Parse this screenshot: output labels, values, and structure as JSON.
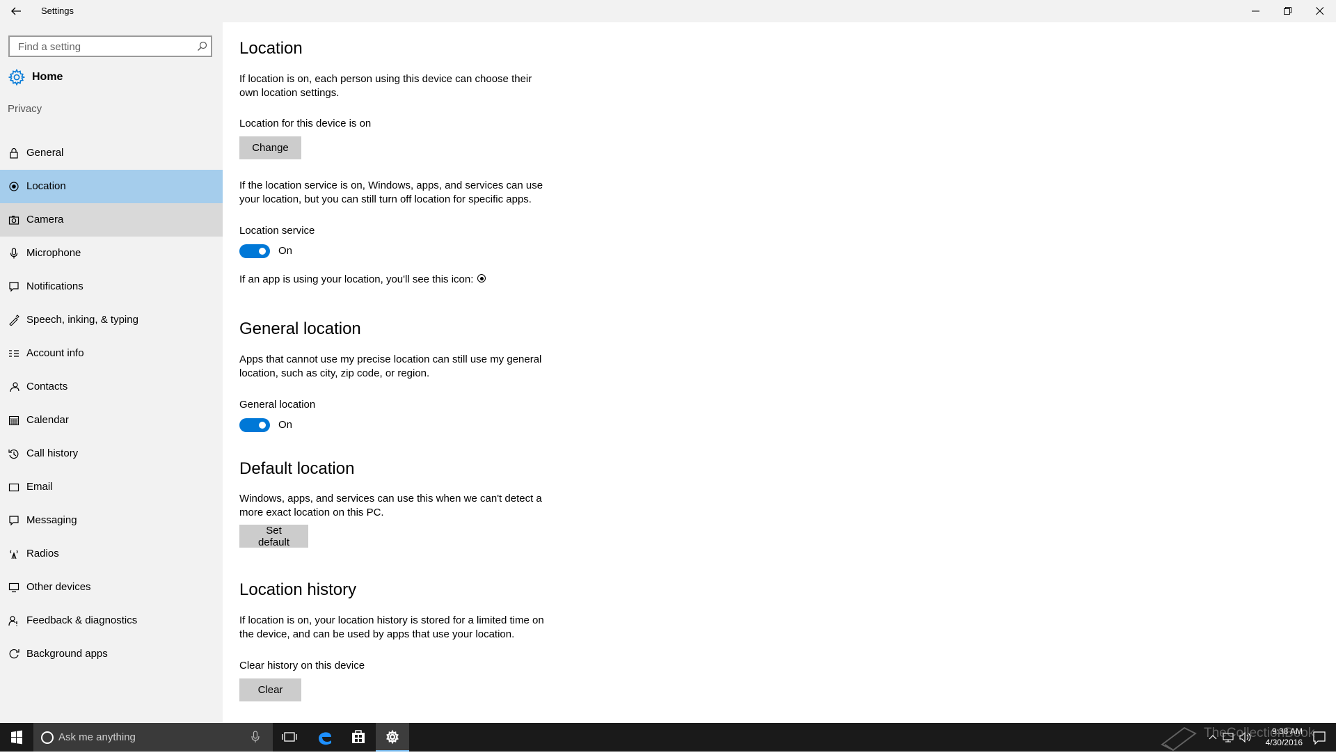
{
  "window": {
    "title": "Settings"
  },
  "sidebar": {
    "search_placeholder": "Find a setting",
    "home_label": "Home",
    "section": "Privacy",
    "items": [
      {
        "label": "General",
        "icon": "lock-icon"
      },
      {
        "label": "Location",
        "icon": "location-icon",
        "state": "selected"
      },
      {
        "label": "Camera",
        "icon": "camera-icon",
        "state": "hover"
      },
      {
        "label": "Microphone",
        "icon": "microphone-icon"
      },
      {
        "label": "Notifications",
        "icon": "notifications-icon"
      },
      {
        "label": "Speech, inking, & typing",
        "icon": "speech-icon"
      },
      {
        "label": "Account info",
        "icon": "account-info-icon"
      },
      {
        "label": "Contacts",
        "icon": "contacts-icon"
      },
      {
        "label": "Calendar",
        "icon": "calendar-icon"
      },
      {
        "label": "Call history",
        "icon": "call-history-icon"
      },
      {
        "label": "Email",
        "icon": "email-icon"
      },
      {
        "label": "Messaging",
        "icon": "messaging-icon"
      },
      {
        "label": "Radios",
        "icon": "radios-icon"
      },
      {
        "label": "Other devices",
        "icon": "other-devices-icon"
      },
      {
        "label": "Feedback & diagnostics",
        "icon": "feedback-icon"
      },
      {
        "label": "Background apps",
        "icon": "background-apps-icon"
      }
    ]
  },
  "main": {
    "location": {
      "heading": "Location",
      "intro": "If location is on, each person using this device can choose their own location settings.",
      "device_status": "Location for this device is on",
      "change_button": "Change",
      "service_desc": "If the location service is on, Windows, apps, and services can use your location, but you can still turn off location for specific apps.",
      "service_label": "Location service",
      "service_state": "On",
      "icon_note": "If an app is using your location, you'll see this icon:"
    },
    "general_location": {
      "heading": "General location",
      "desc": "Apps that cannot use my precise location can still use my general location, such as city, zip code, or region.",
      "toggle_label": "General location",
      "toggle_state": "On"
    },
    "default_location": {
      "heading": "Default location",
      "desc": "Windows, apps, and services can use this when we can't detect a more exact location on this PC.",
      "button": "Set default"
    },
    "location_history": {
      "heading": "Location history",
      "desc": "If location is on, your location history is stored for a limited time on the device, and can be used by apps that use your location.",
      "clear_label": "Clear history on this device",
      "clear_button": "Clear"
    }
  },
  "taskbar": {
    "search_placeholder": "Ask me anything",
    "time": "9:38 AM",
    "date": "4/30/2016",
    "watermark": "TheCollectionBook"
  },
  "colors": {
    "accent": "#0078d7",
    "selected": "#a5cdec",
    "hover": "#d9d9d9",
    "sidebar_bg": "#f2f2f2",
    "taskbar_bg": "#1a1a1a"
  }
}
